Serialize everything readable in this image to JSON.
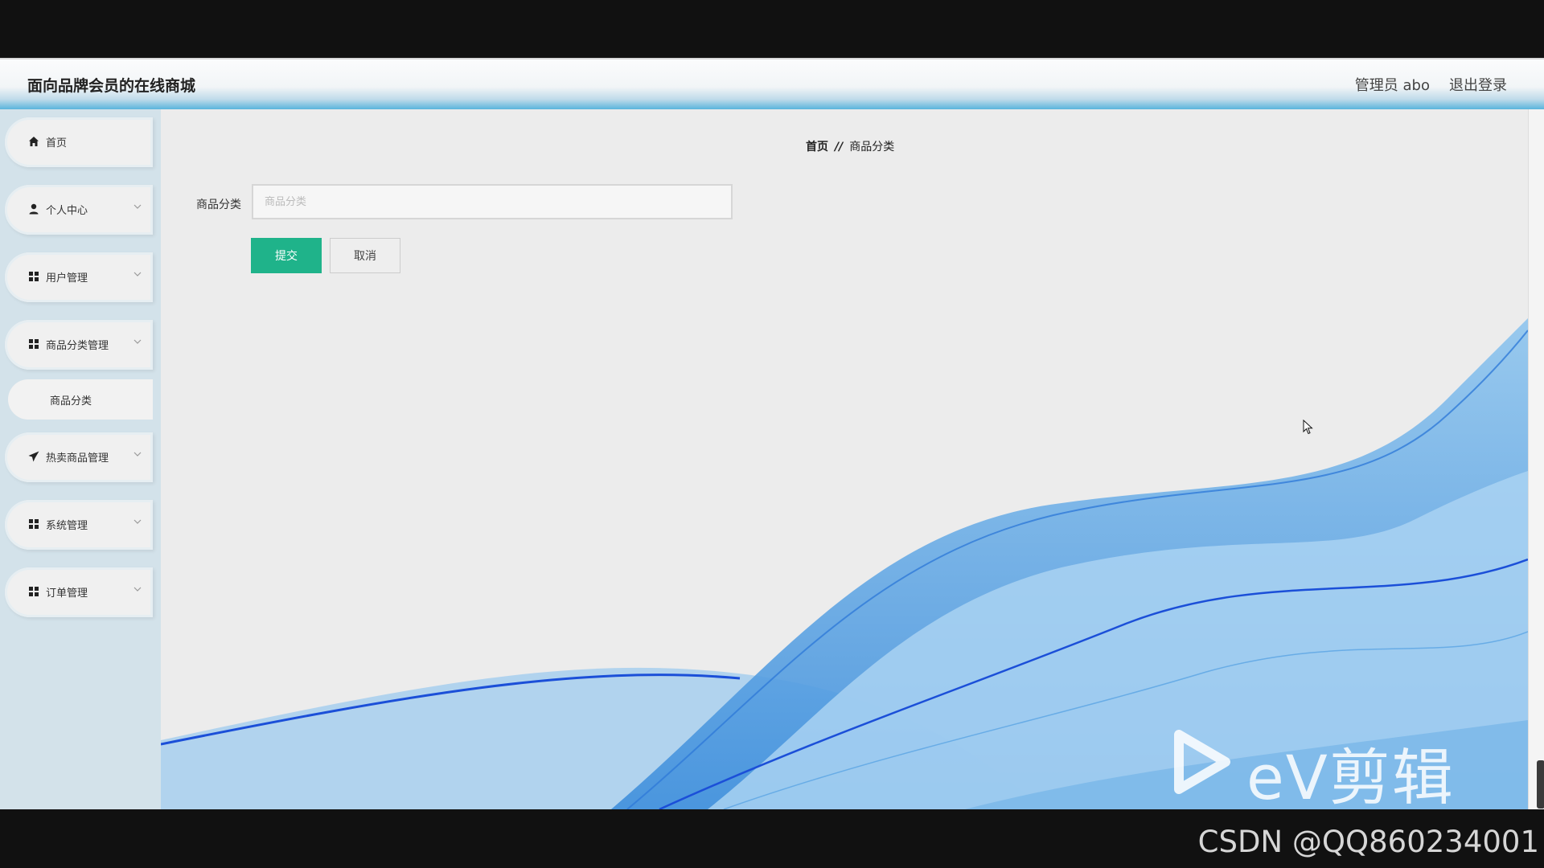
{
  "header": {
    "title": "面向品牌会员的在线商城",
    "admin": "管理员 abo",
    "logout": "退出登录"
  },
  "sidebar": {
    "items": [
      {
        "label": "首页",
        "icon": "home-icon",
        "has_chevron": false
      },
      {
        "label": "个人中心",
        "icon": "user-icon",
        "has_chevron": true
      },
      {
        "label": "用户管理",
        "icon": "grid-icon",
        "has_chevron": true
      },
      {
        "label": "商品分类管理",
        "icon": "grid-icon",
        "has_chevron": true
      },
      {
        "label": "热卖商品管理",
        "icon": "send-icon",
        "has_chevron": true
      },
      {
        "label": "系统管理",
        "icon": "grid-icon",
        "has_chevron": true
      },
      {
        "label": "订单管理",
        "icon": "grid-icon",
        "has_chevron": true
      }
    ],
    "subitem": {
      "label": "商品分类"
    }
  },
  "breadcrumb": {
    "home": "首页",
    "separator": "//",
    "current": "商品分类"
  },
  "form": {
    "field_label": "商品分类",
    "field_placeholder": "商品分类",
    "field_value": "",
    "submit_label": "提交",
    "cancel_label": "取消"
  },
  "colors": {
    "submit": "#1fb38a",
    "sidebar_bg": "#d3e2ea",
    "wave": "#1e73d8"
  },
  "overlay": {
    "watermark_text": "eV剪辑",
    "credit": "CSDN @QQ860234001"
  }
}
